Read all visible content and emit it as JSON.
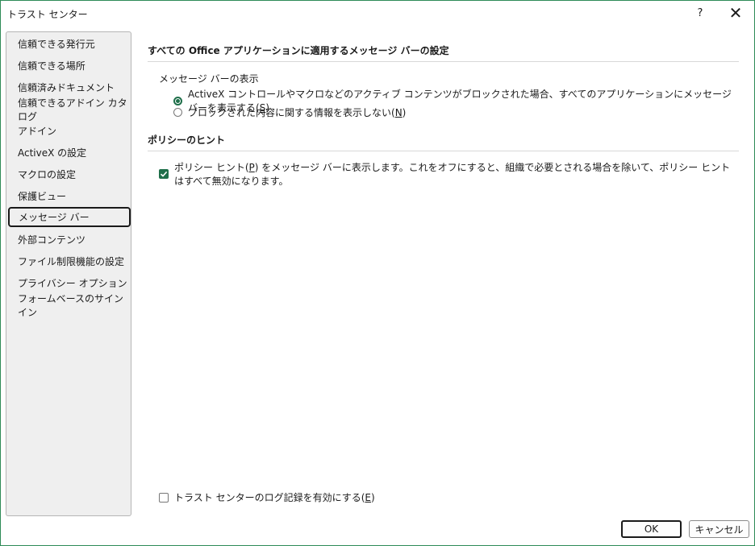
{
  "window": {
    "title": "トラスト センター",
    "help_glyph": "?",
    "close_glyph": "✕",
    "accent_color": "#1f6f4a"
  },
  "sidebar": {
    "items": [
      {
        "label": "信頼できる発行元"
      },
      {
        "label": "信頼できる場所"
      },
      {
        "label": "信頼済みドキュメント"
      },
      {
        "label": "信頼できるアドイン カタログ"
      },
      {
        "label": "アドイン"
      },
      {
        "label": "ActiveX の設定"
      },
      {
        "label": "マクロの設定"
      },
      {
        "label": "保護ビュー"
      },
      {
        "label": "メッセージ バー",
        "selected": true
      },
      {
        "label": "外部コンテンツ"
      },
      {
        "label": "ファイル制限機能の設定"
      },
      {
        "label": "プライバシー オプション"
      },
      {
        "label": "フォームベースのサインイン"
      }
    ]
  },
  "main": {
    "section1_title": "すべての Office アプリケーションに適用するメッセージ バーの設定",
    "group_label": "メッセージ バーの表示",
    "radio1": {
      "text": "ActiveX コントロールやマクロなどのアクティブ コンテンツがブロックされた場合、すべてのアプリケーションにメッセージ バーを表示する(",
      "key": "S",
      "suffix": ")",
      "checked": true
    },
    "radio2": {
      "text": "ブロックされた内容に関する情報を表示しない(",
      "key": "N",
      "suffix": ")",
      "checked": false
    },
    "section2_title": "ポリシーのヒント",
    "policy_check": {
      "text_a": "ポリシー ヒント(",
      "key": "P",
      "text_b": ") をメッセージ バーに表示します。これをオフにすると、組織で必要とされる場合を除いて、ポリシー ヒントはすべて無効になります。",
      "checked": true
    },
    "log_check": {
      "text": "トラスト センターのログ記録を有効にする(",
      "key": "E",
      "suffix": ")",
      "checked": false
    }
  },
  "footer": {
    "ok_label": "OK",
    "cancel_label": "キャンセル"
  }
}
